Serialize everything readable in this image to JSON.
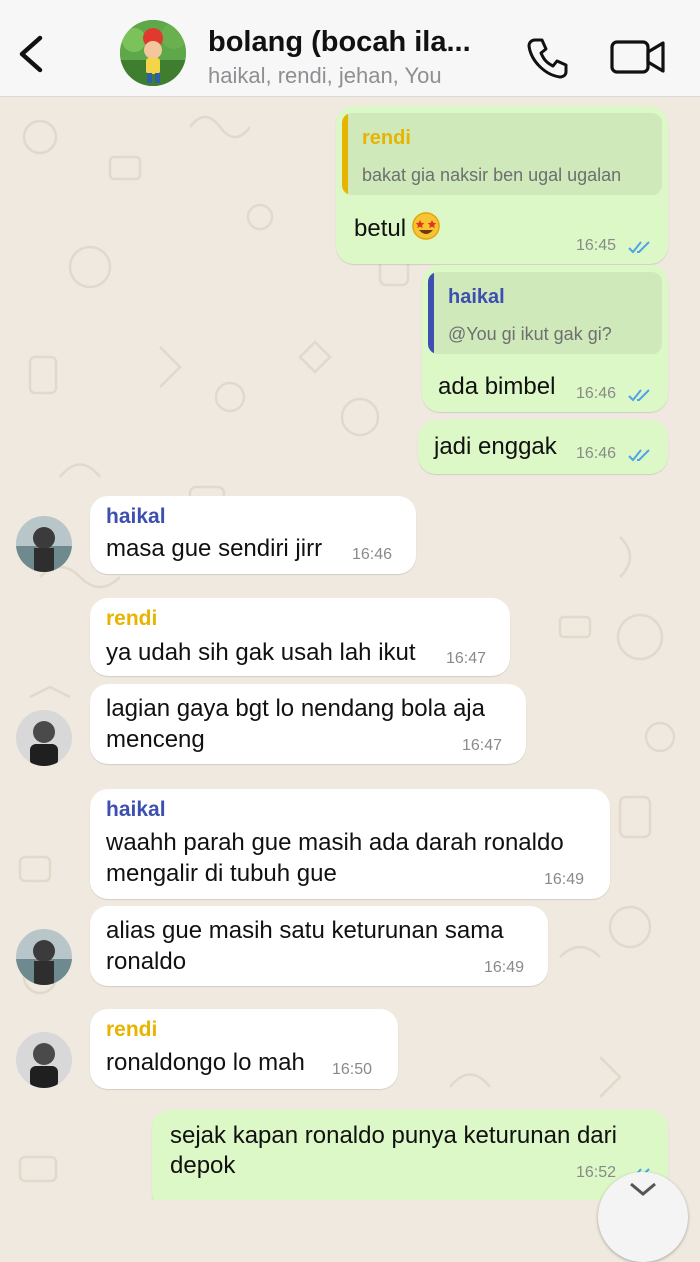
{
  "header": {
    "title": "bolang (bocah ila...",
    "subtitle": "haikal, rendi, jehan, You"
  },
  "colors": {
    "rendi": "#e8b400",
    "haikal": "#3d4fb0",
    "outgoing_bubble": "#dcf8c6",
    "incoming_bubble": "#ffffff",
    "read_ticks": "#4fa3e6"
  },
  "icons": [
    "back-chevron-icon",
    "phone-icon",
    "video-camera-icon",
    "double-check-icon",
    "star-struck-emoji",
    "chevron-down-icon"
  ],
  "messages": [
    {
      "direction": "outgoing",
      "quote": {
        "name": "rendi",
        "text": "bakat gia naksir ben ugal ugalan"
      },
      "text": "betul",
      "emoji": "star-struck",
      "time": "16:45",
      "status": "read"
    },
    {
      "direction": "outgoing",
      "quote": {
        "name": "haikal",
        "text": "@You gi ikut gak gi?"
      },
      "text": "ada bimbel",
      "time": "16:46",
      "status": "read"
    },
    {
      "direction": "outgoing",
      "text": "jadi enggak",
      "time": "16:46",
      "status": "read"
    },
    {
      "direction": "incoming",
      "sender": "haikal",
      "text": "masa gue sendiri jirr",
      "time": "16:46"
    },
    {
      "direction": "incoming",
      "sender": "rendi",
      "text": "ya udah sih gak usah lah ikut",
      "time": "16:47"
    },
    {
      "direction": "incoming",
      "lines": [
        "lagian gaya bgt lo nendang bola aja",
        "menceng"
      ],
      "time": "16:47"
    },
    {
      "direction": "incoming",
      "sender": "haikal",
      "lines": [
        "waahh parah gue masih ada darah ronaldo",
        "mengalir di tubuh gue"
      ],
      "time": "16:49"
    },
    {
      "direction": "incoming",
      "lines": [
        "alias gue masih satu keturunan sama",
        "ronaldo"
      ],
      "time": "16:49"
    },
    {
      "direction": "incoming",
      "sender": "rendi",
      "text": "ronaldongo lo mah",
      "time": "16:50"
    },
    {
      "direction": "outgoing",
      "lines": [
        "sejak kapan ronaldo punya keturunan dari",
        "depok"
      ],
      "time": "16:52",
      "status": "read"
    }
  ]
}
